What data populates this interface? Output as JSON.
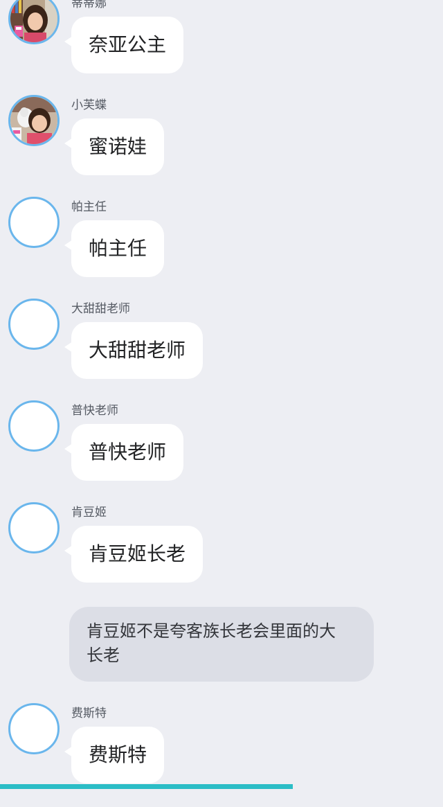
{
  "messages": [
    {
      "sender": "蒂蒂娜",
      "text": "奈亚公主",
      "avatar": "avatar-photo-girl-classroom"
    },
    {
      "sender": "小芙蝶",
      "text": "蜜诺娃",
      "avatar": "avatar-photo-girl-pink"
    },
    {
      "sender": "帕主任",
      "text": "帕主任",
      "avatar": "avatar-empty"
    },
    {
      "sender": "大甜甜老师",
      "text": "大甜甜老师",
      "avatar": "avatar-empty"
    },
    {
      "sender": "普快老师",
      "text": "普快老师",
      "avatar": "avatar-empty"
    },
    {
      "sender": "肯豆姬",
      "text": "肯豆姬长老",
      "avatar": "avatar-empty"
    }
  ],
  "system_note": {
    "line1": "肯豆姬不是夸客族长老会里面的大",
    "line2": "长老"
  },
  "last_message": {
    "sender": "费斯特",
    "text": "费斯特",
    "avatar": "avatar-empty"
  },
  "colors": {
    "background": "#edeef3",
    "bubble": "#ffffff",
    "avatar_ring": "#6ab6ec",
    "system_bubble": "#dcdee6",
    "bottom_bar": "#2bbdc6"
  }
}
